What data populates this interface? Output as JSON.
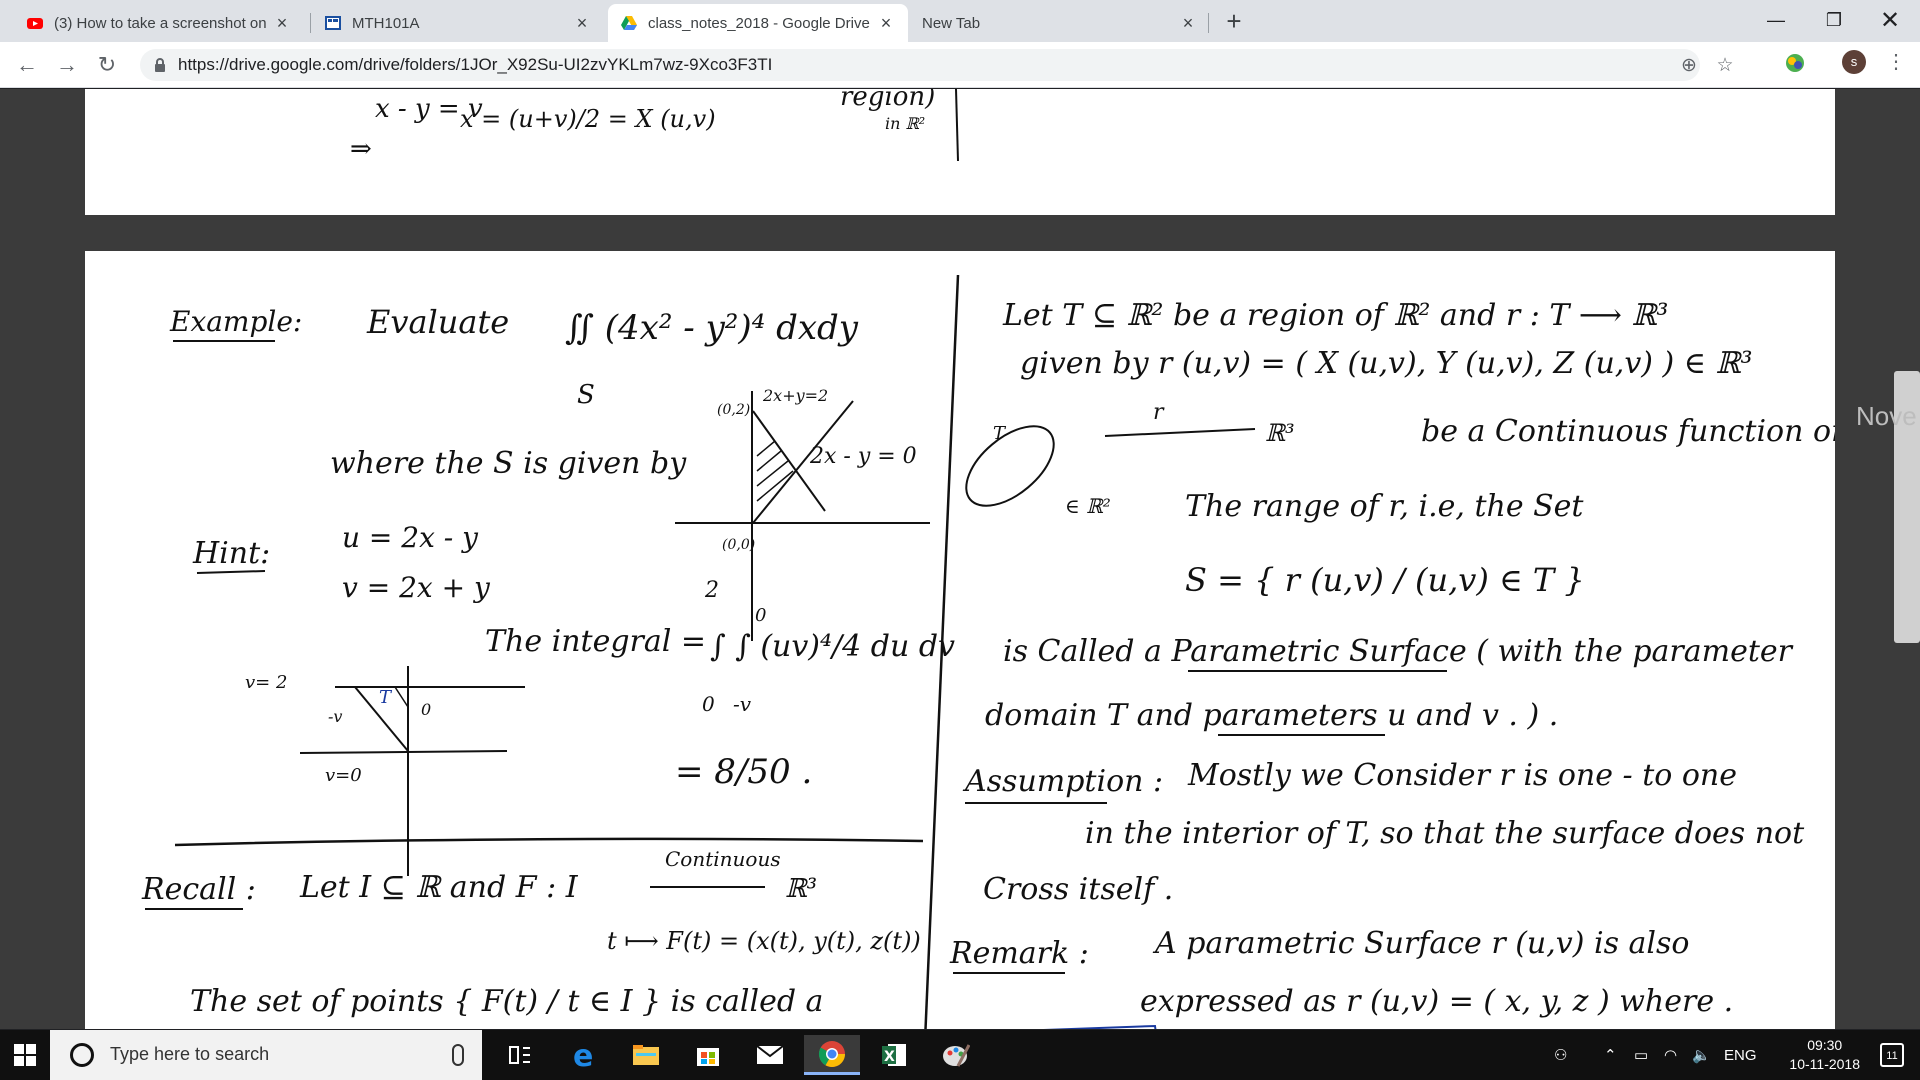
{
  "browser": {
    "tabs": [
      {
        "label": "(3) How to take a screenshot on",
        "icon": "youtube-icon",
        "active": false
      },
      {
        "label": "MTH101A",
        "icon": "classroom-icon",
        "active": false
      },
      {
        "label": "class_notes_2018 - Google Drive",
        "icon": "google-drive-icon",
        "active": true
      },
      {
        "label": "New Tab",
        "icon": "none",
        "active": false
      }
    ],
    "url": "https://drive.google.com/drive/folders/1JOr_X92Su-UI2zvYKLm7wz-9Xco3F3TI",
    "profile_initial": "s"
  },
  "notes": {
    "page1": {
      "line1": "x - y = v",
      "line2": "x = (u+v)/2 = X (u,v)",
      "implies": "⇒",
      "region": "region)",
      "region2": "in ℝ²"
    },
    "example": {
      "label": "Example:",
      "evaluate": "Evaluate",
      "integral": "∬ (4x² - y²)⁴ dxdy",
      "over": "S",
      "where": "where the S is given by",
      "hint": "Hint:",
      "u": "u = 2x - y",
      "v": "v = 2x + y",
      "integral_eq": "The integral =",
      "iterated": "∫ ∫ (uv)⁴/4 du dv",
      "lim_upper_outer": "2",
      "lim_lower_outer": "0",
      "lim_upper_inner": "0",
      "lim_lower_inner": "-v",
      "result": "= 8/50 .",
      "graph_point_top": "(0,2)",
      "graph_point_origin": "(0,0)",
      "graph_line1": "2x+y=2",
      "graph_line2": "2x - y = 0",
      "region_label": "T",
      "region_minus_v": "-v",
      "region_zero": "0",
      "v2": "v= 2",
      "v0": "v=0"
    },
    "recall": {
      "label": "Recall :",
      "line1": "Let I ⊆ ℝ and F : I",
      "continuous": "Continuous",
      "r3": "ℝ³",
      "map": "t ⟼ F(t) = (x(t), y(t), z(t))",
      "line2": "The set of points { F(t) / t ∈ I } is called a"
    },
    "right": {
      "line1": "Let T ⊆ ℝ² be a region of ℝ² and r : T ⟶ ℝ³",
      "line2": "given by   r (u,v) = ( X (u,v),  Y (u,v),  Z (u,v) ) ∈ ℝ³",
      "diag_T": "T",
      "diag_r": "r",
      "diag_r3": "ℝ³",
      "diag_r2": "∈ ℝ²",
      "line3": "be a Continuous function on T.",
      "line4": "The range of r,  i.e,  the Set",
      "line5": "S = { r (u,v) / (u,v) ∈ T }",
      "line6": "is Called a  Parametric Surface  ( with the parameter",
      "line7": "domain T and  parameters  u and v . ) .",
      "assumption": "Assumption :",
      "line8": "Mostly  we Consider  r  is  one - to one",
      "line9": "in the interior of T,  so that  the surface does not",
      "line10": "Cross  itself .",
      "remark": "Remark :",
      "line11": "A  parametric Surface  r (u,v)  is  also",
      "line12": "expressed as    r (u,v) = ( x, y, z )  where ."
    },
    "side_peek": "Nove"
  },
  "taskbar": {
    "search_placeholder": "Type here to search",
    "language": "ENG",
    "time": "09:30",
    "date": "10-11-2018",
    "notification_count": "11"
  }
}
